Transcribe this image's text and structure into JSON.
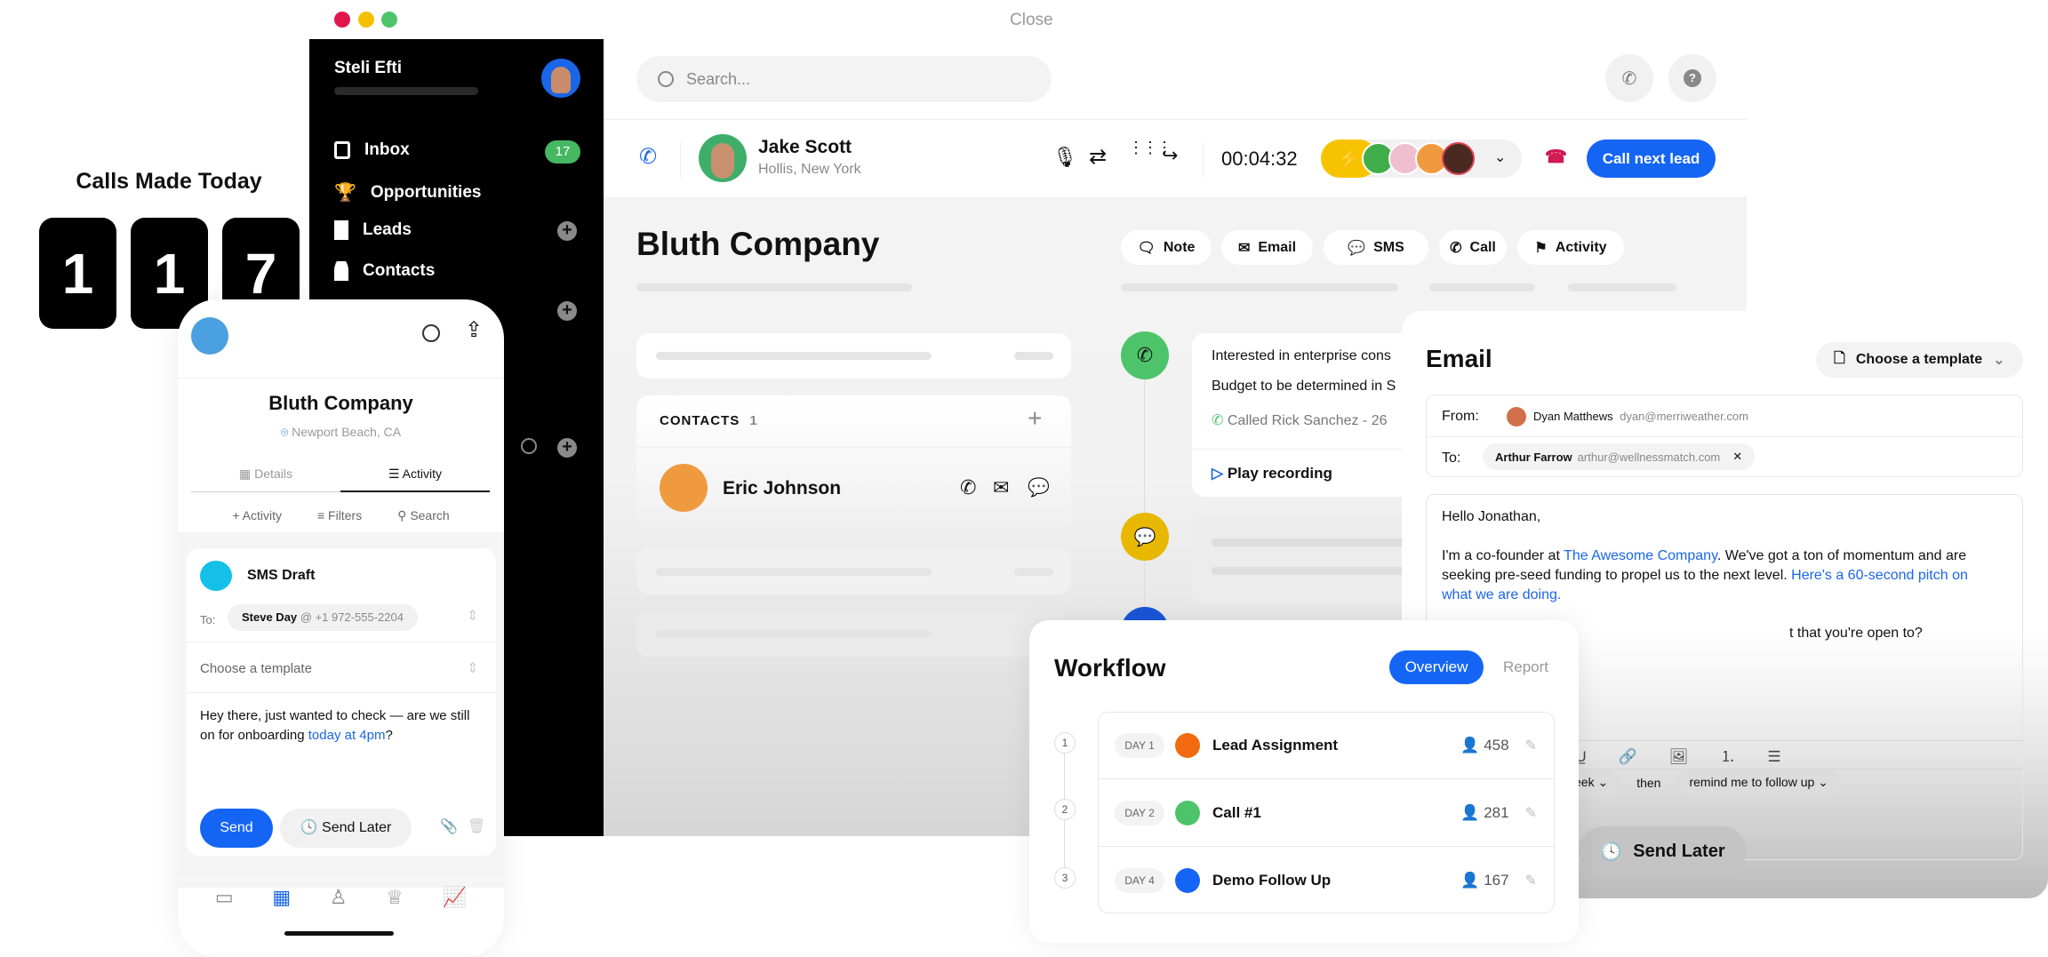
{
  "window": {
    "close_label": "Close",
    "traffic_lights": [
      "#e0164f",
      "#f5c000",
      "#4ec46a"
    ]
  },
  "stats": {
    "title": "Calls Made Today",
    "digits": [
      "1",
      "1",
      "7"
    ]
  },
  "sidebar": {
    "user_name": "Steli Efti",
    "nav": [
      {
        "label": "Inbox",
        "icon": "inbox-icon",
        "badge": "17"
      },
      {
        "label": "Opportunities",
        "icon": "trophy-icon"
      },
      {
        "label": "Leads",
        "icon": "building-icon"
      },
      {
        "label": "Contacts",
        "icon": "person-icon"
      }
    ]
  },
  "topbar": {
    "search_placeholder": "Search..."
  },
  "call_bar": {
    "contact_name": "Jake Scott",
    "contact_location": "Hollis, New York",
    "timer": "00:04:32",
    "cta": "Call next lead",
    "accent": "#1565f5"
  },
  "company": {
    "name": "Bluth Company",
    "actions": [
      "Note",
      "Email",
      "SMS",
      "Call",
      "Activity"
    ],
    "contacts_header": "CONTACTS",
    "contacts_count": "1",
    "contact_name": "Eric Johnson"
  },
  "timeline": {
    "line1": "Interested in enterprise cons",
    "line2": "Budget to be determined in S",
    "call_log": "Called Rick Sanchez - 26",
    "play": "Play recording"
  },
  "email": {
    "title": "Email",
    "template_label": "Choose a template",
    "from_label": "From:",
    "from_name": "Dyan Matthews",
    "from_email": "dyan@merriweather.com",
    "to_label": "To:",
    "to_name": "Arthur Farrow",
    "to_email": "arthur@wellnessmatch.com",
    "greeting": "Hello Jonathan,",
    "p1_a": "I'm a co-founder at ",
    "p1_link": "The Awesome Company",
    "p1_b": ". We've got a ton of momentum and are seeking pre-seed funding to propel us to the next level. ",
    "p1_link2": "Here's a 60-second pitch on what we are doing.",
    "p2_partial": "t that you're open to?",
    "schedule_partial": "eek",
    "then": "then",
    "remind": "remind me to follow up",
    "send_later": "Send Later"
  },
  "workflow": {
    "title": "Workflow",
    "tabs": [
      "Overview",
      "Report"
    ],
    "steps": [
      {
        "num": "1",
        "day": "DAY 1",
        "name": "Lead Assignment",
        "count": "458",
        "color": "#f26a12"
      },
      {
        "num": "2",
        "day": "DAY 2",
        "name": "Call #1",
        "count": "281",
        "color": "#4ec46a"
      },
      {
        "num": "3",
        "day": "DAY 4",
        "name": "Demo Follow Up",
        "count": "167",
        "color": "#1565f5"
      }
    ]
  },
  "mobile": {
    "company": "Bluth Company",
    "location": "Newport Beach, CA",
    "tabs": [
      "Details",
      "Activity"
    ],
    "subactions": [
      "Activity",
      "Filters",
      "Search"
    ],
    "sms_title": "SMS Draft",
    "to_label": "To:",
    "to_name": "Steve Day",
    "to_number": "@ +1 972-555-2204",
    "template": "Choose a template",
    "msg_a": "Hey there, just wanted to check — are we still on for onboarding ",
    "msg_link": "today at 4pm",
    "msg_b": "?",
    "send": "Send",
    "send_later": "Send Later"
  }
}
